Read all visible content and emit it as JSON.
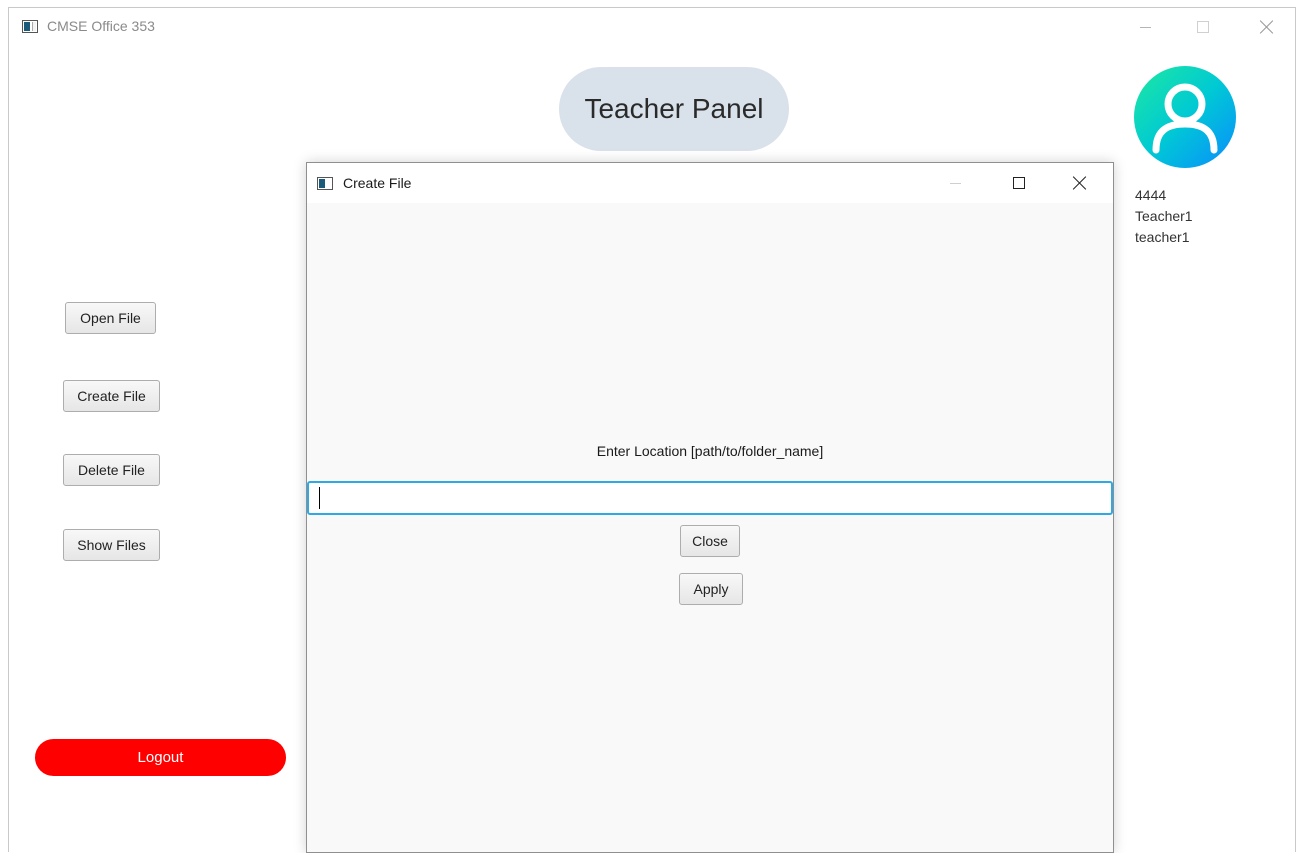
{
  "window": {
    "title": "CMSE Office 353",
    "icon": "app-icon"
  },
  "header": {
    "panel_title": "Teacher Panel"
  },
  "user": {
    "avatar_icon": "user-avatar-icon",
    "id": "4444",
    "name": "Teacher1",
    "username": "teacher1"
  },
  "sidebar": {
    "open_file": "Open File",
    "create_file": "Create File",
    "delete_file": "Delete File",
    "show_files": "Show Files",
    "logout": "Logout"
  },
  "dialog": {
    "title": "Create File",
    "prompt": "Enter Location [path/to/folder_name]",
    "input_value": "",
    "close_label": "Close",
    "apply_label": "Apply"
  },
  "colors": {
    "logout_bg": "#ff0000",
    "title_pill_bg": "#d9e1ea",
    "input_focus": "#2fa9e4"
  }
}
